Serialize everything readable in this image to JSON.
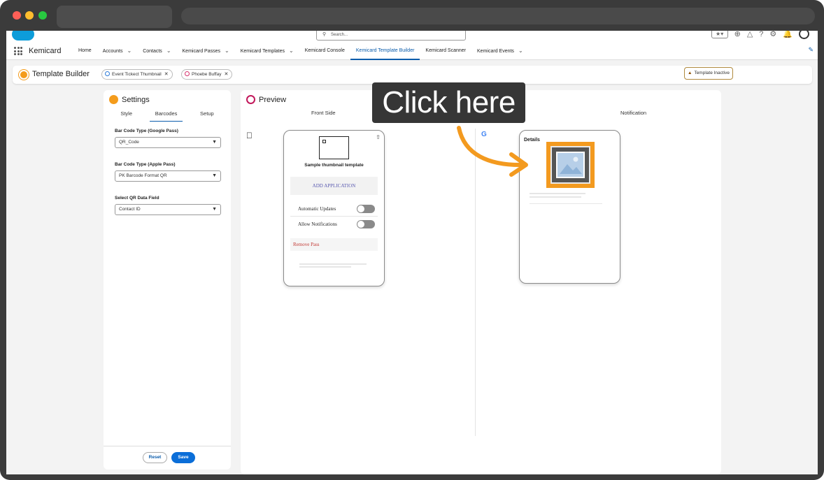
{
  "browser": {},
  "global_header": {
    "search_placeholder": "Search..."
  },
  "nav": {
    "app_name": "Kemicard",
    "items": [
      {
        "label": "Home",
        "chevron": false,
        "active": false
      },
      {
        "label": "Accounts",
        "chevron": true,
        "active": false
      },
      {
        "label": "Contacts",
        "chevron": true,
        "active": false
      },
      {
        "label": "Kemicard Passes",
        "chevron": true,
        "active": false
      },
      {
        "label": "Kemicard Templates",
        "chevron": true,
        "active": false
      },
      {
        "label": "Kemicard Console",
        "chevron": false,
        "active": false
      },
      {
        "label": "Kemicard Template Builder",
        "chevron": false,
        "active": true
      },
      {
        "label": "Kemicard Scanner",
        "chevron": false,
        "active": false
      },
      {
        "label": "Kemicard Events",
        "chevron": true,
        "active": false
      }
    ]
  },
  "builder_bar": {
    "title": "Template Builder",
    "pill1": "Event Tickect Thumbnail",
    "pill2": "Phoebe Buffay",
    "status": "Template Inactive"
  },
  "settings": {
    "title": "Settings",
    "tabs": [
      "Style",
      "Barcodes",
      "Setup"
    ],
    "active_tab": "Barcodes",
    "field1_label": "Bar Code Type (Google Pass)",
    "field1_value": "QR_Code",
    "field2_label": "Bar Code Type (Apple Pass)",
    "field2_value": "PK Barcode Format QR",
    "field3_label": "Select QR Data Field",
    "field3_value": "Contact ID",
    "reset_label": "Reset",
    "save_label": "Save"
  },
  "preview": {
    "title": "Preview",
    "tab_front": "Front Side",
    "tab_notification": "Notification",
    "apple_card": {
      "title": "Sample thumbnail template",
      "add_application": "ADD APPLICATION",
      "automatic_updates": "Automatic Updates",
      "allow_notifications": "Allow Notifications",
      "remove_pass": "Remove Pass"
    },
    "google_card": {
      "details": "Details"
    }
  },
  "overlay": {
    "callout": "Click here",
    "accent": "#f39a1f"
  }
}
